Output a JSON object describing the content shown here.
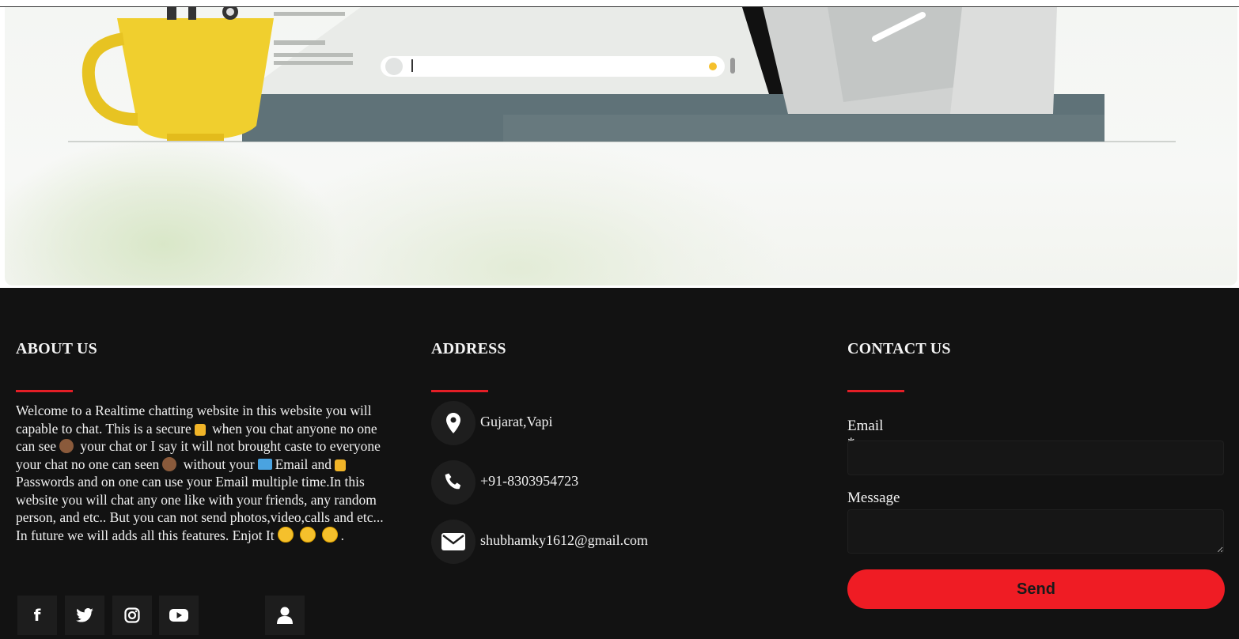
{
  "footer": {
    "about": {
      "heading": "ABOUT US",
      "text_1": "Welcome to a Realtime chatting website in this website you will capable to chat. This is a secure",
      "text_2": " when you chat anyone no one can see",
      "text_3": " your chat or I say it will not brought caste to everyone your chat no one can seen",
      "text_4": " without your",
      "text_5": "Email and",
      "text_6": "Passwords and on one can use your Email multiple time.In this website you will chat any one like with your friends, any random person, and etc.. But you can not send photos,video,calls and etc... In future we will adds all this features. Enjot It",
      "text_end": ".",
      "social": [
        {
          "icon": "facebook-icon",
          "glyph": "f"
        },
        {
          "icon": "twitter-icon",
          "glyph": "🐦"
        },
        {
          "icon": "instagram-icon",
          "glyph": "◎"
        },
        {
          "icon": "youtube-icon",
          "glyph": "▶"
        },
        {
          "icon": "user-icon",
          "glyph": "👤"
        }
      ]
    },
    "address": {
      "heading": "ADDRESS",
      "location": "Gujarat,Vapi",
      "phone": "+91-8303954723",
      "email": "shubhamky1612@gmail.com"
    },
    "contact": {
      "heading": "CONTACT US",
      "email_label": "Email *",
      "email_value": "",
      "message_label": "Message *",
      "message_value": "",
      "send_label": "Send"
    }
  },
  "colors": {
    "accent": "#e41e26",
    "footer_bg": "#121212",
    "send_button": "#ef1c24"
  }
}
